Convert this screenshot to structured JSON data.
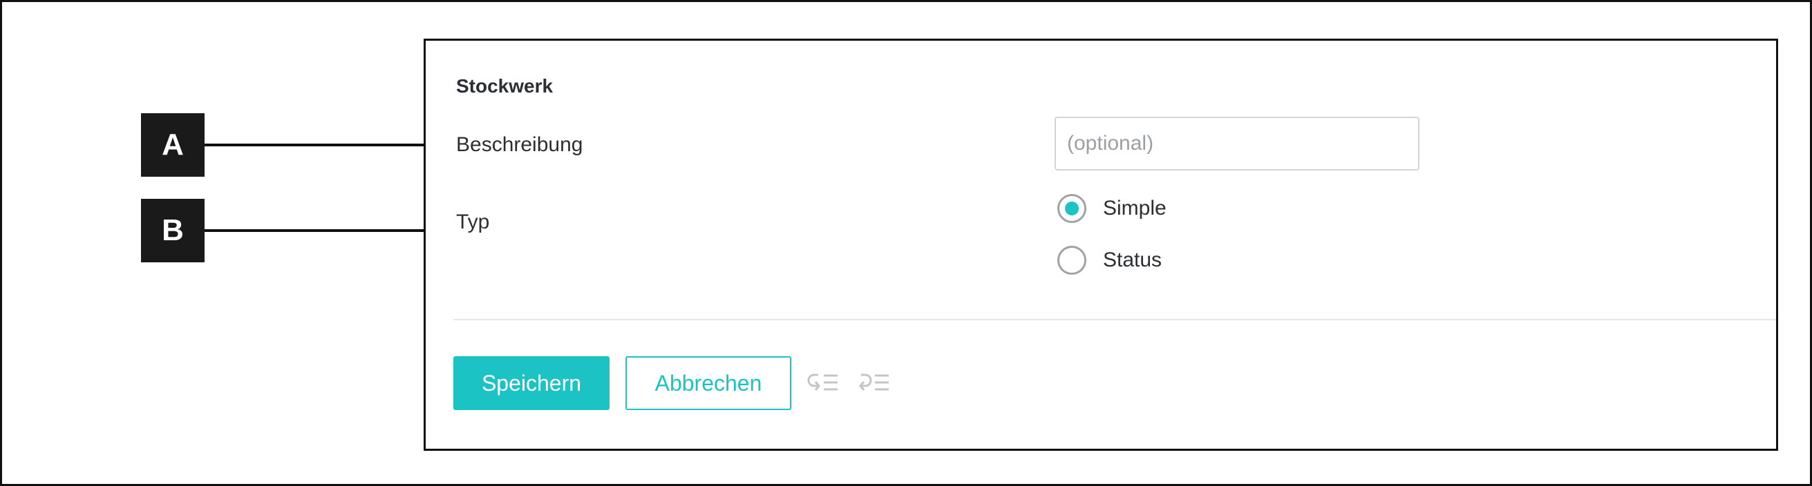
{
  "form": {
    "section_title": "Stockwerk",
    "description": {
      "label": "Beschreibung",
      "value": "",
      "placeholder": "(optional)"
    },
    "type": {
      "label": "Typ",
      "options": [
        {
          "label": "Simple",
          "selected": true
        },
        {
          "label": "Status",
          "selected": false
        }
      ]
    }
  },
  "actions": {
    "save_label": "Speichern",
    "cancel_label": "Abbrechen",
    "icons": [
      "outdent-icon",
      "indent-icon"
    ]
  },
  "callouts": {
    "a": "A",
    "b": "B"
  },
  "colors": {
    "accent": "#1cc3c4",
    "text": "#2b2f33",
    "callout_bg": "#1a1a1a",
    "icon_disabled": "#c2c6ca"
  }
}
